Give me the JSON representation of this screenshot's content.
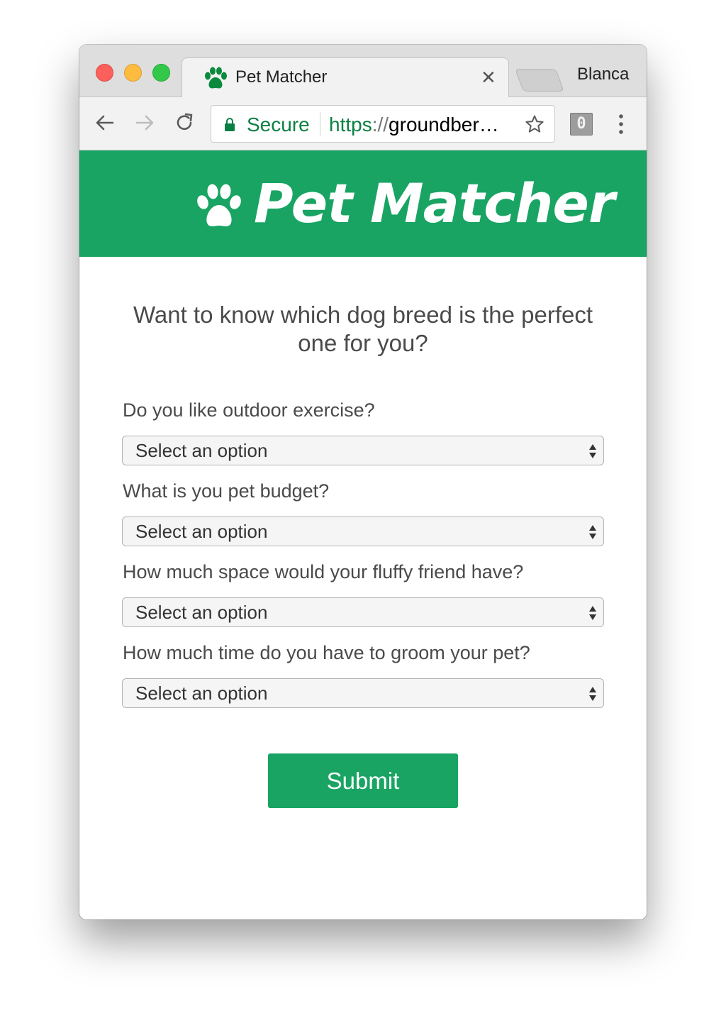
{
  "browser": {
    "tab": {
      "title": "Pet Matcher",
      "favicon": "paw-icon"
    },
    "profile_name": "Blanca",
    "address_bar": {
      "secure_label": "Secure",
      "url_scheme": "https",
      "url_separator": "://",
      "url_host": "groundber…"
    },
    "extension_badge": "0"
  },
  "page": {
    "brand": {
      "title": "Pet Matcher",
      "icon": "paw-icon",
      "color": "#19a463"
    },
    "headline": "Want to know which dog breed is the perfect one for you?",
    "questions": [
      {
        "label": "Do you like outdoor exercise?",
        "selected": "Select an option"
      },
      {
        "label": "What is you pet budget?",
        "selected": "Select an option"
      },
      {
        "label": "How much space would your fluffy friend have?",
        "selected": "Select an option"
      },
      {
        "label": "How much time do you have to groom your pet?",
        "selected": "Select an option"
      }
    ],
    "submit_label": "Submit"
  }
}
